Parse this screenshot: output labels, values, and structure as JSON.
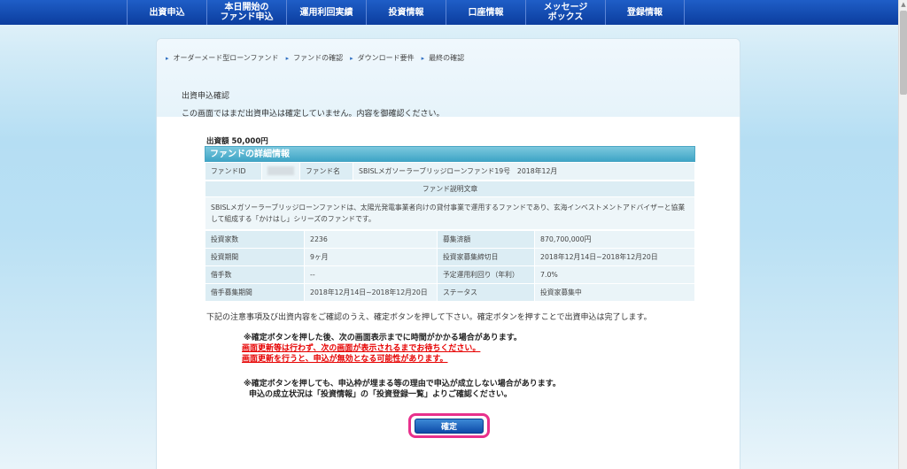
{
  "nav": [
    {
      "label": "出資申込"
    },
    {
      "label": "本日開始の\nファンド申込"
    },
    {
      "label": "運用利回実績"
    },
    {
      "label": "投資情報"
    },
    {
      "label": "口座情報"
    },
    {
      "label": "メッセージ\nボックス"
    },
    {
      "label": "登録情報"
    }
  ],
  "breadcrumb": [
    "オーダーメード型ローンファンド",
    "ファンドの確認",
    "ダウンロード要件",
    "最終の確認"
  ],
  "heading": "出資申込確認",
  "notice": "この画面ではまだ出資申込は確定していません。内容を御確認ください。",
  "amount": "出資額 50,000円",
  "fund": {
    "header": "ファンドの詳細情報",
    "id_label": "ファンドID",
    "name_label": "ファンド名",
    "name_value": "SBISLメガソーラーブリッジローンファンド19号　2018年12月",
    "desc_label": "ファンド説明文章",
    "description": "SBISLメガソーラーブリッジローンファンドは、太陽光発電事業者向けの貸付事業で運用するファンドであり、玄海インベストメントアドバイザーと協業して組成する「かけはし」シリーズのファンドです。",
    "rows": [
      {
        "l1": "投資家数",
        "v1": "2236",
        "l2": "募集済額",
        "v2": "870,700,000円"
      },
      {
        "l1": "投資期間",
        "v1": "9ヶ月",
        "l2": "投資家募集締切日",
        "v2": "2018年12月14日~2018年12月20日"
      },
      {
        "l1": "借手数",
        "v1": "--",
        "l2": "予定運用利回り（年利）",
        "v2": "7.0%"
      },
      {
        "l1": "借手募集期間",
        "v1": "2018年12月14日~2018年12月20日",
        "l2": "ステータス",
        "v2": "投資家募集中"
      }
    ]
  },
  "instruction": "下記の注意事項及び出資内容をご確認のうえ、確定ボタンを押して下さい。確定ボタンを押すことで出資申込は完了します。",
  "notes": {
    "n1": "※確定ボタンを押した後、次の画面表示までに時間がかかる場合があります。",
    "r1": "画面更新等は行わず、次の画面が表示されるまでお待ちください。",
    "r2": "画面更新を行うと、申込が無効となる可能性があります。",
    "n2": "※確定ボタンを押しても、申込枠が埋まる等の理由で申込が成立しない場合があります。",
    "n3": "申込の成立状況は「投資情報」の「投資登録一覧」よりご確認ください。"
  },
  "confirm_label": "確定",
  "colors": {
    "nav": "#0b3d9e",
    "table_header": "#3fa5c6",
    "warning": "#e60000",
    "highlight": "#e8308c"
  }
}
